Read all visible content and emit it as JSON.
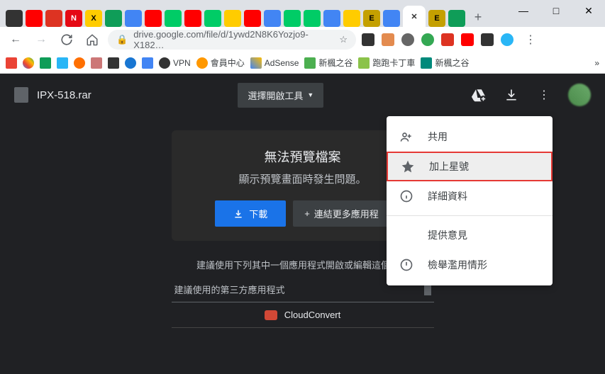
{
  "window": {
    "minimize": "—",
    "maximize": "□",
    "close": "✕"
  },
  "tabs": {
    "active_close": "✕",
    "newtab": "+"
  },
  "nav": {
    "back": "←",
    "forward": "→",
    "reload": "⟳",
    "home": "⌂",
    "lock": "🔒",
    "url": "drive.google.com/file/d/1ywd2N8K6Yozjo9-X182…",
    "star": "☆"
  },
  "bookmarks": {
    "vpn": "VPN",
    "member": "會員中心",
    "adsense": "AdSense",
    "maple1": "新楓之谷",
    "kart": "跑跑卡丁車",
    "maple2": "新楓之谷",
    "overflow": "»"
  },
  "viewer": {
    "filename": "IPX-518.rar",
    "openwith": "選擇開啟工具",
    "caret": "▼",
    "preview_title": "無法預覽檔案",
    "preview_sub": "顯示預覽畫面時發生問題。",
    "download": "下載",
    "connect_more": "連結更多應用程",
    "plus": "+",
    "suggest_text": "建議使用下列其中一個應用程式開啟或編輯這個項目",
    "suggest_header": "建議使用的第三方應用程式",
    "cloudconvert": "CloudConvert"
  },
  "menu": {
    "share": "共用",
    "star": "加上星號",
    "details": "詳細資料",
    "feedback": "提供意見",
    "report": "檢舉濫用情形"
  }
}
